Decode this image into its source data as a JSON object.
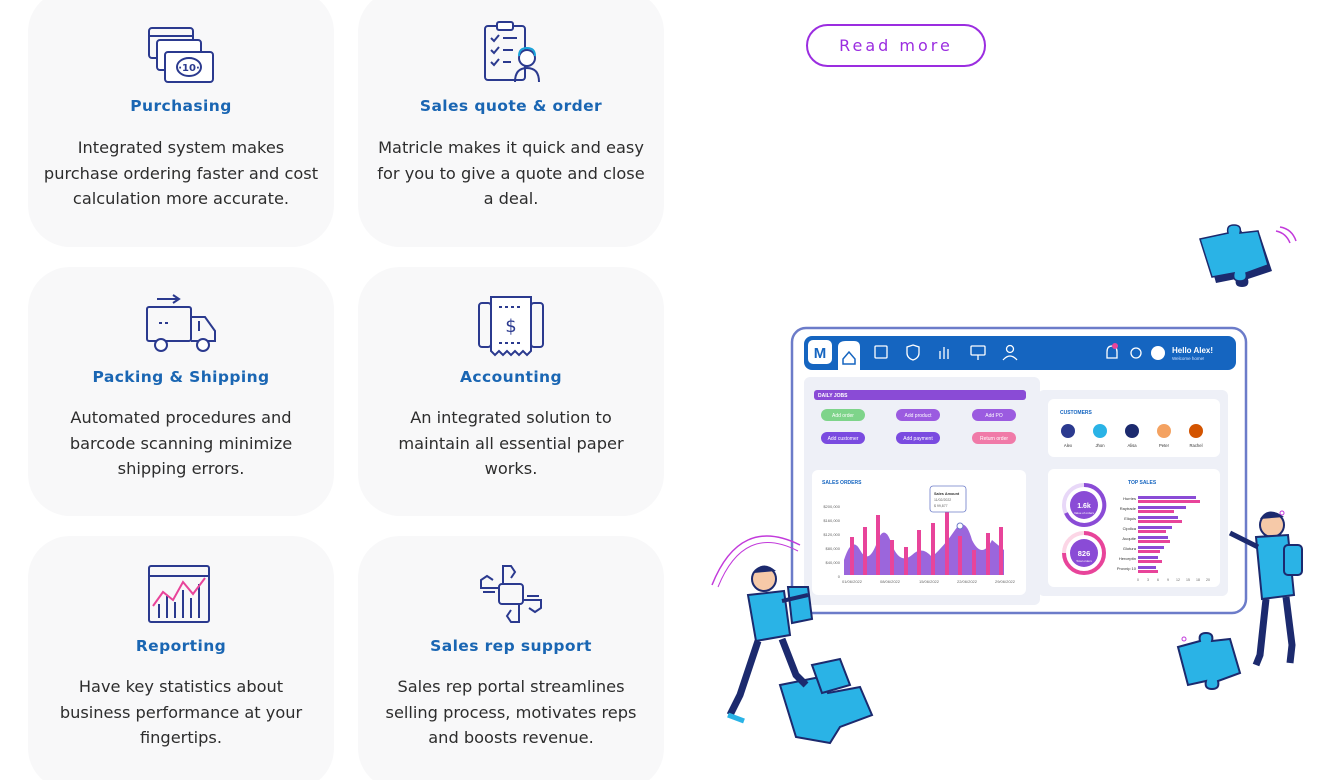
{
  "features": [
    {
      "title": "Purchasing",
      "description": "Integrated system makes purchase ordering faster and cost calculation more accurate.",
      "icon": "money-cards-icon"
    },
    {
      "title": "Sales quote & order",
      "description": "Matricle makes it quick and easy for you to give a quote and close a deal.",
      "icon": "clipboard-agent-icon"
    },
    {
      "title": "Packing & Shipping",
      "description": "Automated procedures and barcode scanning minimize shipping errors.",
      "icon": "delivery-truck-icon"
    },
    {
      "title": "Accounting",
      "description": "An integrated solution to maintain all essential paper works.",
      "icon": "receipt-dollar-icon"
    },
    {
      "title": "Reporting",
      "description": "Have key statistics about business performance at your fingertips.",
      "icon": "line-chart-icon"
    },
    {
      "title": "Sales rep support",
      "description": "Sales rep portal streamlines selling process, motivates reps and boosts revenue.",
      "icon": "hands-teamwork-icon"
    }
  ],
  "read_more_label": "Read more",
  "dashboard": {
    "logo": "M",
    "greeting": "Hello Alex!",
    "greeting_sub": "Welcome home!",
    "daily_jobs_label": "DAILY JOBS",
    "job_buttons": [
      "Add order",
      "Add product",
      "Add PO",
      "Add customer",
      "Add payment",
      "Return order"
    ],
    "customers_label": "CUSTOMERS",
    "customers": [
      "Alex",
      "Jhon",
      "Alisa",
      "Peter",
      "Rachel"
    ],
    "sales_orders_label": "SALES ORDERS",
    "tooltip_title": "Sales Amount",
    "tooltip_date": "11/02/2022",
    "tooltip_value": "$ 99,877",
    "y_ticks": [
      "$200,000",
      "$160,000",
      "$120,000",
      "$80,000",
      "$40,000",
      "0"
    ],
    "x_ticks": [
      "01/06/2022",
      "08/06/2022",
      "15/06/2022",
      "22/06/2022",
      "29/06/2022"
    ],
    "top_sales_label": "TOP SALES",
    "stat1_value": "1.6k",
    "stat1_label": "Value of orders",
    "stat2_value": "826",
    "stat2_label": "Total orders",
    "top_sales_names": [
      "Hurries",
      "Raytrade",
      "Eliquis",
      "Cipdica",
      "Auquite",
      "Glotura",
      "Herceptin",
      "Provnip 10"
    ],
    "top_sales_ticks": [
      "0",
      "3",
      "6",
      "9",
      "12",
      "15",
      "18",
      "20"
    ]
  },
  "colors": {
    "accent": "#9b2de0",
    "title_blue": "#1a66b3",
    "icon_navy": "#2b3a8f",
    "dash_blue": "#1565c0",
    "pink": "#e8449a",
    "purple": "#8a4bd6"
  }
}
